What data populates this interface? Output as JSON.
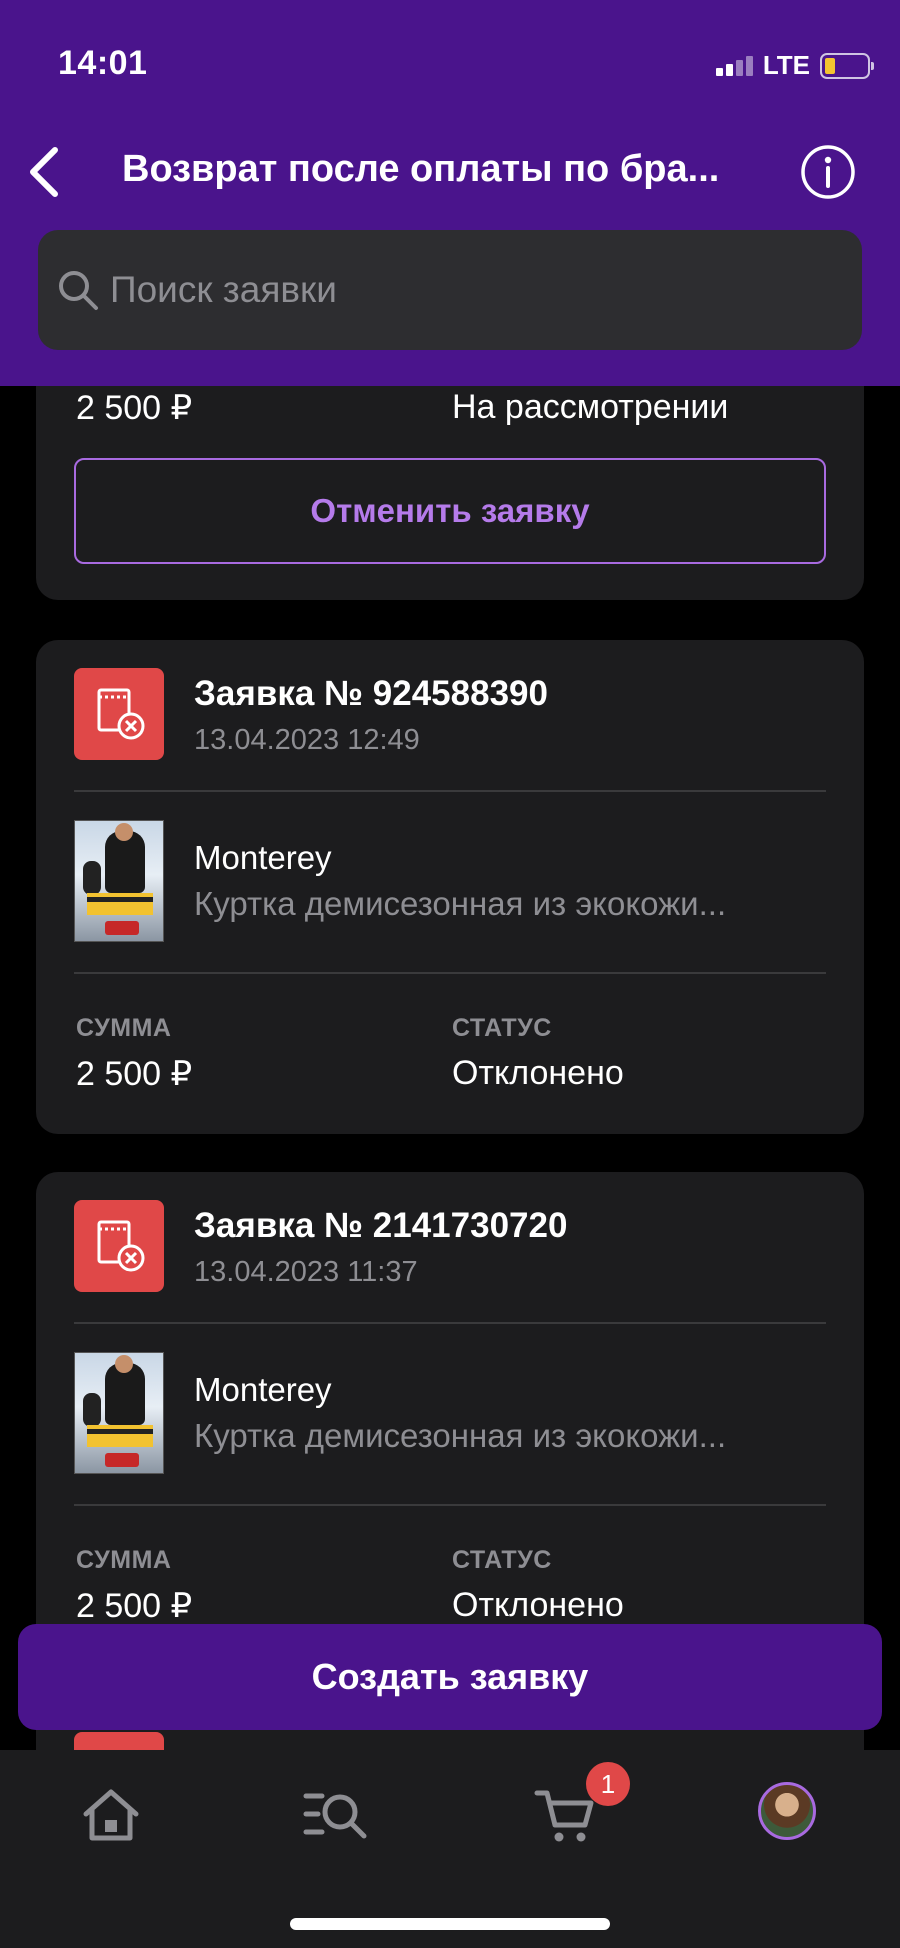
{
  "status_bar": {
    "time": "14:01",
    "network": "LTE"
  },
  "header": {
    "title": "Возврат после оплаты по бра..."
  },
  "search": {
    "placeholder": "Поиск заявки"
  },
  "top_card": {
    "amount": "2 500 ₽",
    "status": "На рассмотрении",
    "cancel_label": "Отменить заявку"
  },
  "requests": [
    {
      "title": "Заявка № 924588390",
      "date": "13.04.2023 12:49",
      "brand": "Monterey",
      "product": "Куртка демисезонная из экокожи...",
      "amount_label": "СУММА",
      "amount": "2 500 ₽",
      "status_label": "СТАТУС",
      "status": "Отклонено"
    },
    {
      "title": "Заявка № 2141730720",
      "date": "13.04.2023 11:37",
      "brand": "Monterey",
      "product": "Куртка демисезонная из экокожи...",
      "amount_label": "СУММА",
      "amount": "2 500 ₽",
      "status_label": "СТАТУС",
      "status": "Отклонено"
    }
  ],
  "create_button": "Создать заявку",
  "tabbar": {
    "cart_badge": "1"
  },
  "colors": {
    "brand_purple": "#4a148c",
    "danger": "#e04848",
    "accent": "#a86ae0"
  }
}
